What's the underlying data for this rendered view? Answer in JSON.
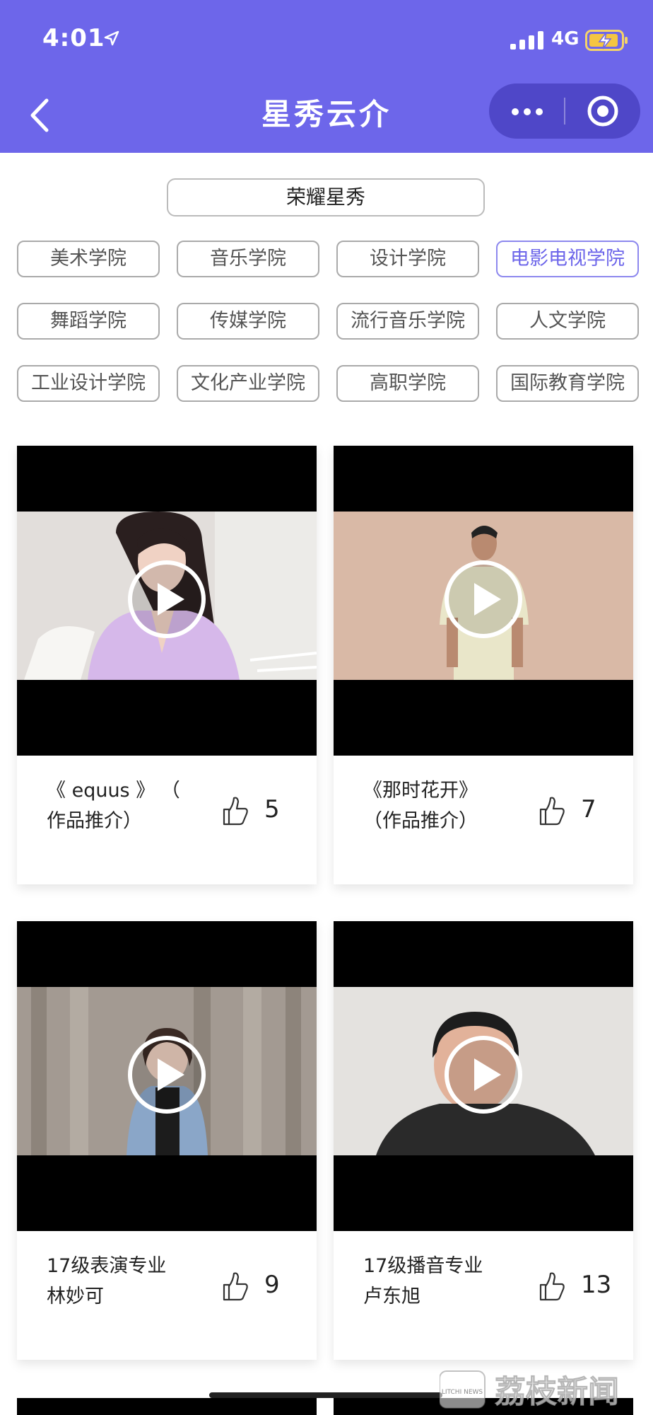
{
  "status_bar": {
    "time": "4:01",
    "network": "4G"
  },
  "header": {
    "title": "星秀云介"
  },
  "selector": {
    "value": "荣耀星秀"
  },
  "tags": [
    {
      "label": "美术学院",
      "active": false
    },
    {
      "label": "音乐学院",
      "active": false
    },
    {
      "label": "设计学院",
      "active": false
    },
    {
      "label": "电影电视学院",
      "active": true
    },
    {
      "label": "舞蹈学院",
      "active": false
    },
    {
      "label": "传媒学院",
      "active": false
    },
    {
      "label": "流行音乐学院",
      "active": false
    },
    {
      "label": "人文学院",
      "active": false
    },
    {
      "label": "工业设计学院",
      "active": false
    },
    {
      "label": "文化产业学院",
      "active": false
    },
    {
      "label": "高职学院",
      "active": false
    },
    {
      "label": "国际教育学院",
      "active": false
    }
  ],
  "cards": [
    {
      "line1": "《 equus 》 （",
      "line2": "作品推介）",
      "likes": "5"
    },
    {
      "line1": "《那时花开》",
      "line2": "（作品推介）",
      "likes": "7"
    },
    {
      "line1": "17级表演专业",
      "line2": "林妙可",
      "likes": "9"
    },
    {
      "line1": "17级播音专业",
      "line2": "卢东旭",
      "likes": "13"
    }
  ],
  "watermark": {
    "text": "荔枝新闻",
    "sub": "LITCHI NEWS"
  },
  "colors": {
    "theme": "#6d66ea",
    "capsule": "#4f47c8",
    "active_tag": "#6d66ea"
  },
  "icons": [
    "location-arrow-icon",
    "signal-icon",
    "battery-charging-icon",
    "back-chevron-icon",
    "more-dots-icon",
    "close-target-icon",
    "play-icon",
    "thumbs-up-icon"
  ]
}
